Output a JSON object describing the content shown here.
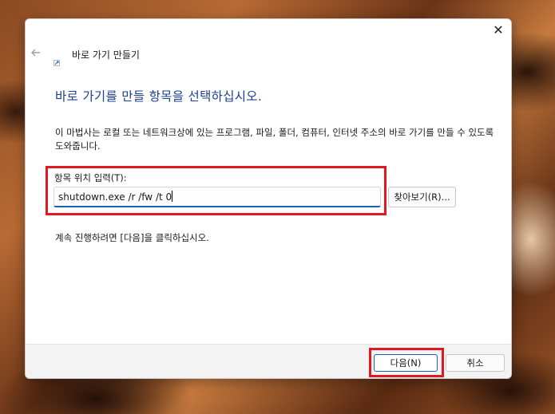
{
  "wizard": {
    "title": "바로 가기 만들기",
    "heading": "바로 가기를 만들 항목을 선택하십시오.",
    "description": "이 마법사는 로컬 또는 네트워크상에 있는 프로그램, 파일, 폴더, 컴퓨터, 인터넷 주소의 바로 가기를 만들 수 있도록 도와줍니다.",
    "location_label": "항목 위치 입력(T):",
    "location_value": "shutdown.exe /r /fw /t 0",
    "browse_label": "찾아보기(R)...",
    "continue_text": "계속 진행하려면 [다음]을 클릭하십시오.",
    "next_label": "다음(N)",
    "cancel_label": "취소",
    "close_glyph": "✕"
  },
  "colors": {
    "heading": "#1c3f94",
    "accent": "#1b5fb8",
    "highlight": "#e01a22",
    "footer_bg": "#f3f3f3"
  },
  "icons": [
    "back-arrow-icon",
    "shortcut-icon",
    "close-icon"
  ]
}
